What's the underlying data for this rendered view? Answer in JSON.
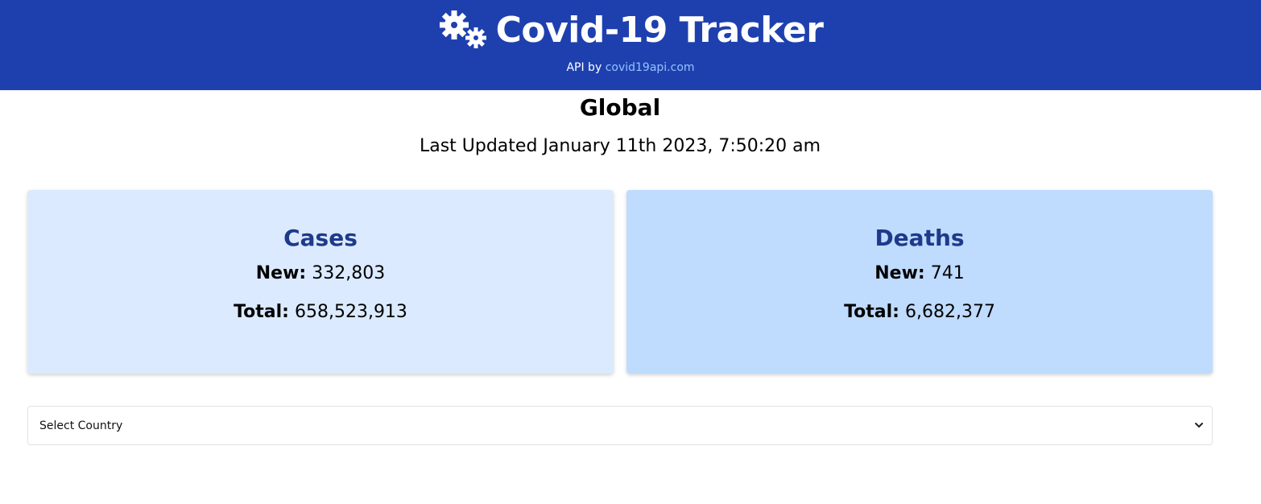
{
  "header": {
    "title": "Covid-19 Tracker",
    "api_prefix": "API by ",
    "api_link": "covid19api.com",
    "icon": "gears-icon",
    "background_color": "#1e40af",
    "link_color": "#93c5fd"
  },
  "global": {
    "title": "Global",
    "last_updated": "Last Updated January 11th 2023, 7:50:20 am"
  },
  "cards": {
    "cases": {
      "title": "Cases",
      "new_label": "New:",
      "new_value": "332,803",
      "total_label": "Total:",
      "total_value": "658,523,913",
      "background_color": "#dbeafe"
    },
    "deaths": {
      "title": "Deaths",
      "new_label": "New:",
      "new_value": "741",
      "total_label": "Total:",
      "total_value": "6,682,377",
      "background_color": "#bfdbfe"
    }
  },
  "country_select": {
    "selected": "Select Country",
    "icon": "chevron-down-icon"
  }
}
